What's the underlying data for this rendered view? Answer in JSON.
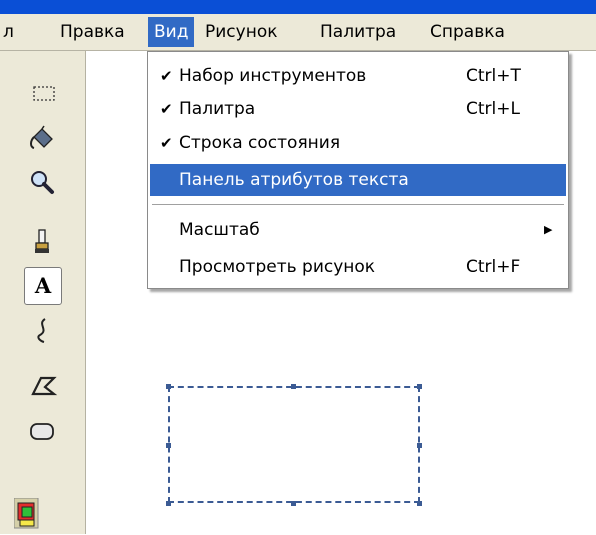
{
  "menubar": {
    "items": [
      {
        "label": "л"
      },
      {
        "label": "Правка"
      },
      {
        "label": "Вид"
      },
      {
        "label": "Рисунок"
      },
      {
        "label": "Палитра"
      },
      {
        "label": "Справка"
      }
    ]
  },
  "view_menu": {
    "items": [
      {
        "check": "✔",
        "label": "Набор инструментов",
        "shortcut": "Ctrl+T"
      },
      {
        "check": "✔",
        "label": "Палитра",
        "shortcut": "Ctrl+L"
      },
      {
        "check": "✔",
        "label": "Строка состояния",
        "shortcut": ""
      },
      {
        "check": "",
        "label": "Панель атрибутов текста",
        "shortcut": "",
        "highlighted": true
      },
      {
        "check": "",
        "label": "Масштаб",
        "shortcut": "",
        "submenu_arrow": "▶"
      },
      {
        "check": "",
        "label": "Просмотреть рисунок",
        "shortcut": "Ctrl+F"
      }
    ]
  },
  "toolbox": {
    "tools": [
      {
        "icon": "select-rectangle-icon"
      },
      {
        "icon": "fill-bucket-icon"
      },
      {
        "icon": "magnifier-icon"
      },
      {
        "icon": "brush-icon"
      },
      {
        "icon": "text-tool-icon",
        "glyph": "A",
        "selected": true
      },
      {
        "icon": "curve-icon"
      },
      {
        "icon": "polygon-icon"
      },
      {
        "icon": "rounded-rectangle-icon"
      }
    ]
  },
  "colors": {
    "title_bar": "#0a4fd6",
    "menu_highlight": "#316ac5",
    "chrome": "#ece9d8"
  }
}
